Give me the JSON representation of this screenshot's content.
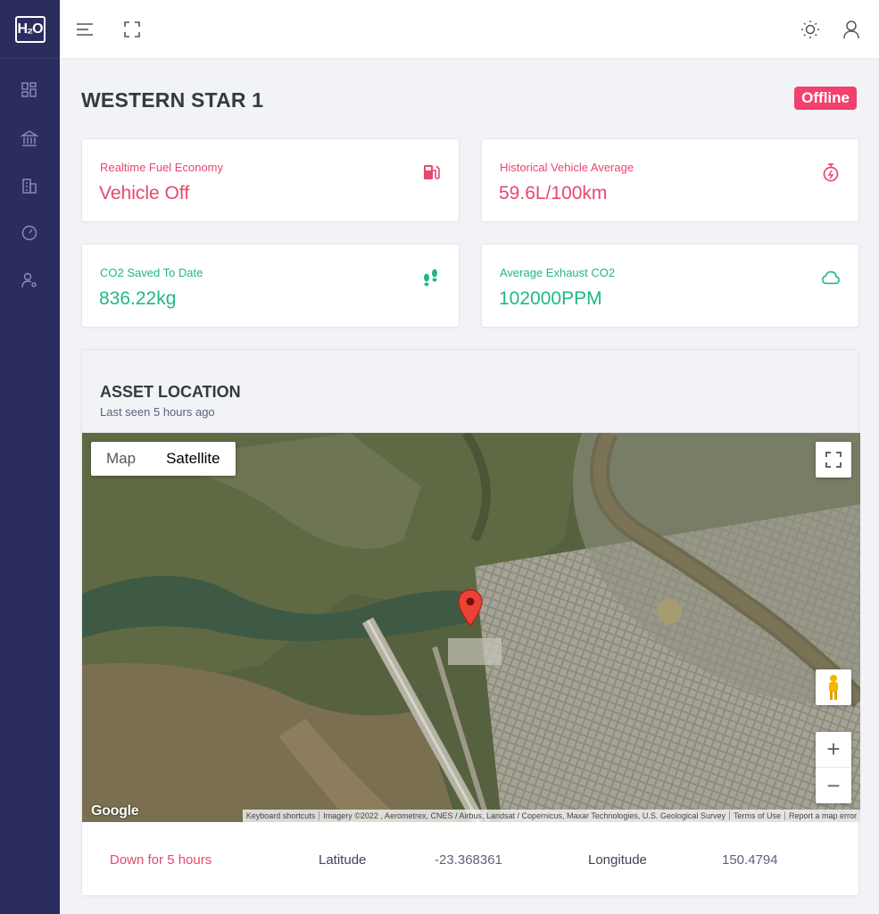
{
  "brand": {
    "logo_text": "H₂O"
  },
  "sidebar": {
    "items": [
      {
        "icon": "dashboard-grid-icon"
      },
      {
        "icon": "bank-icon"
      },
      {
        "icon": "building-icon"
      },
      {
        "icon": "speedometer-icon"
      },
      {
        "icon": "user-settings-icon"
      }
    ]
  },
  "topbar": {
    "menu_icon": "menu-icon",
    "fullscreen_icon": "fullscreen-icon",
    "theme_icon": "sun-icon",
    "user_icon": "user-icon"
  },
  "page": {
    "title": "WESTERN STAR 1",
    "status": "Offline"
  },
  "stats": [
    {
      "label": "Realtime Fuel Economy",
      "value": "Vehicle Off",
      "icon": "fuel-pump-icon",
      "color": "#e8476e"
    },
    {
      "label": "Historical Vehicle Average",
      "value": "59.6L/100km",
      "icon": "stopwatch-icon",
      "color": "#e8476e"
    },
    {
      "label": "CO2 Saved To Date",
      "value": "836.22kg",
      "icon": "footprints-icon",
      "color": "#20b882"
    },
    {
      "label": "Average Exhaust CO2",
      "value": "102000PPM",
      "icon": "cloud-icon",
      "color": "#20b882"
    }
  ],
  "location": {
    "title": "ASSET LOCATION",
    "subtitle": "Last seen 5 hours ago",
    "map": {
      "type_buttons": [
        "Map",
        "Satellite"
      ],
      "selected_type": "Satellite",
      "zoom_in": "+",
      "zoom_out": "−",
      "google": "Google",
      "attribution": [
        "Keyboard shortcuts",
        "Imagery ©2022 , Aerometrex, CNES / Airbus, Landsat / Copernicus, Maxar Technologies, U.S. Geological Survey",
        "Terms of Use",
        "Report a map error"
      ]
    },
    "footer": {
      "status": "Down for 5 hours",
      "latitude_label": "Latitude",
      "latitude_value": "-23.368361",
      "longitude_label": "Longitude",
      "longitude_value": "150.4794"
    }
  },
  "colors": {
    "sidebar": "#2b2d5f",
    "danger": "#f1416c",
    "red_text": "#e8476e",
    "green_text": "#20b882"
  }
}
